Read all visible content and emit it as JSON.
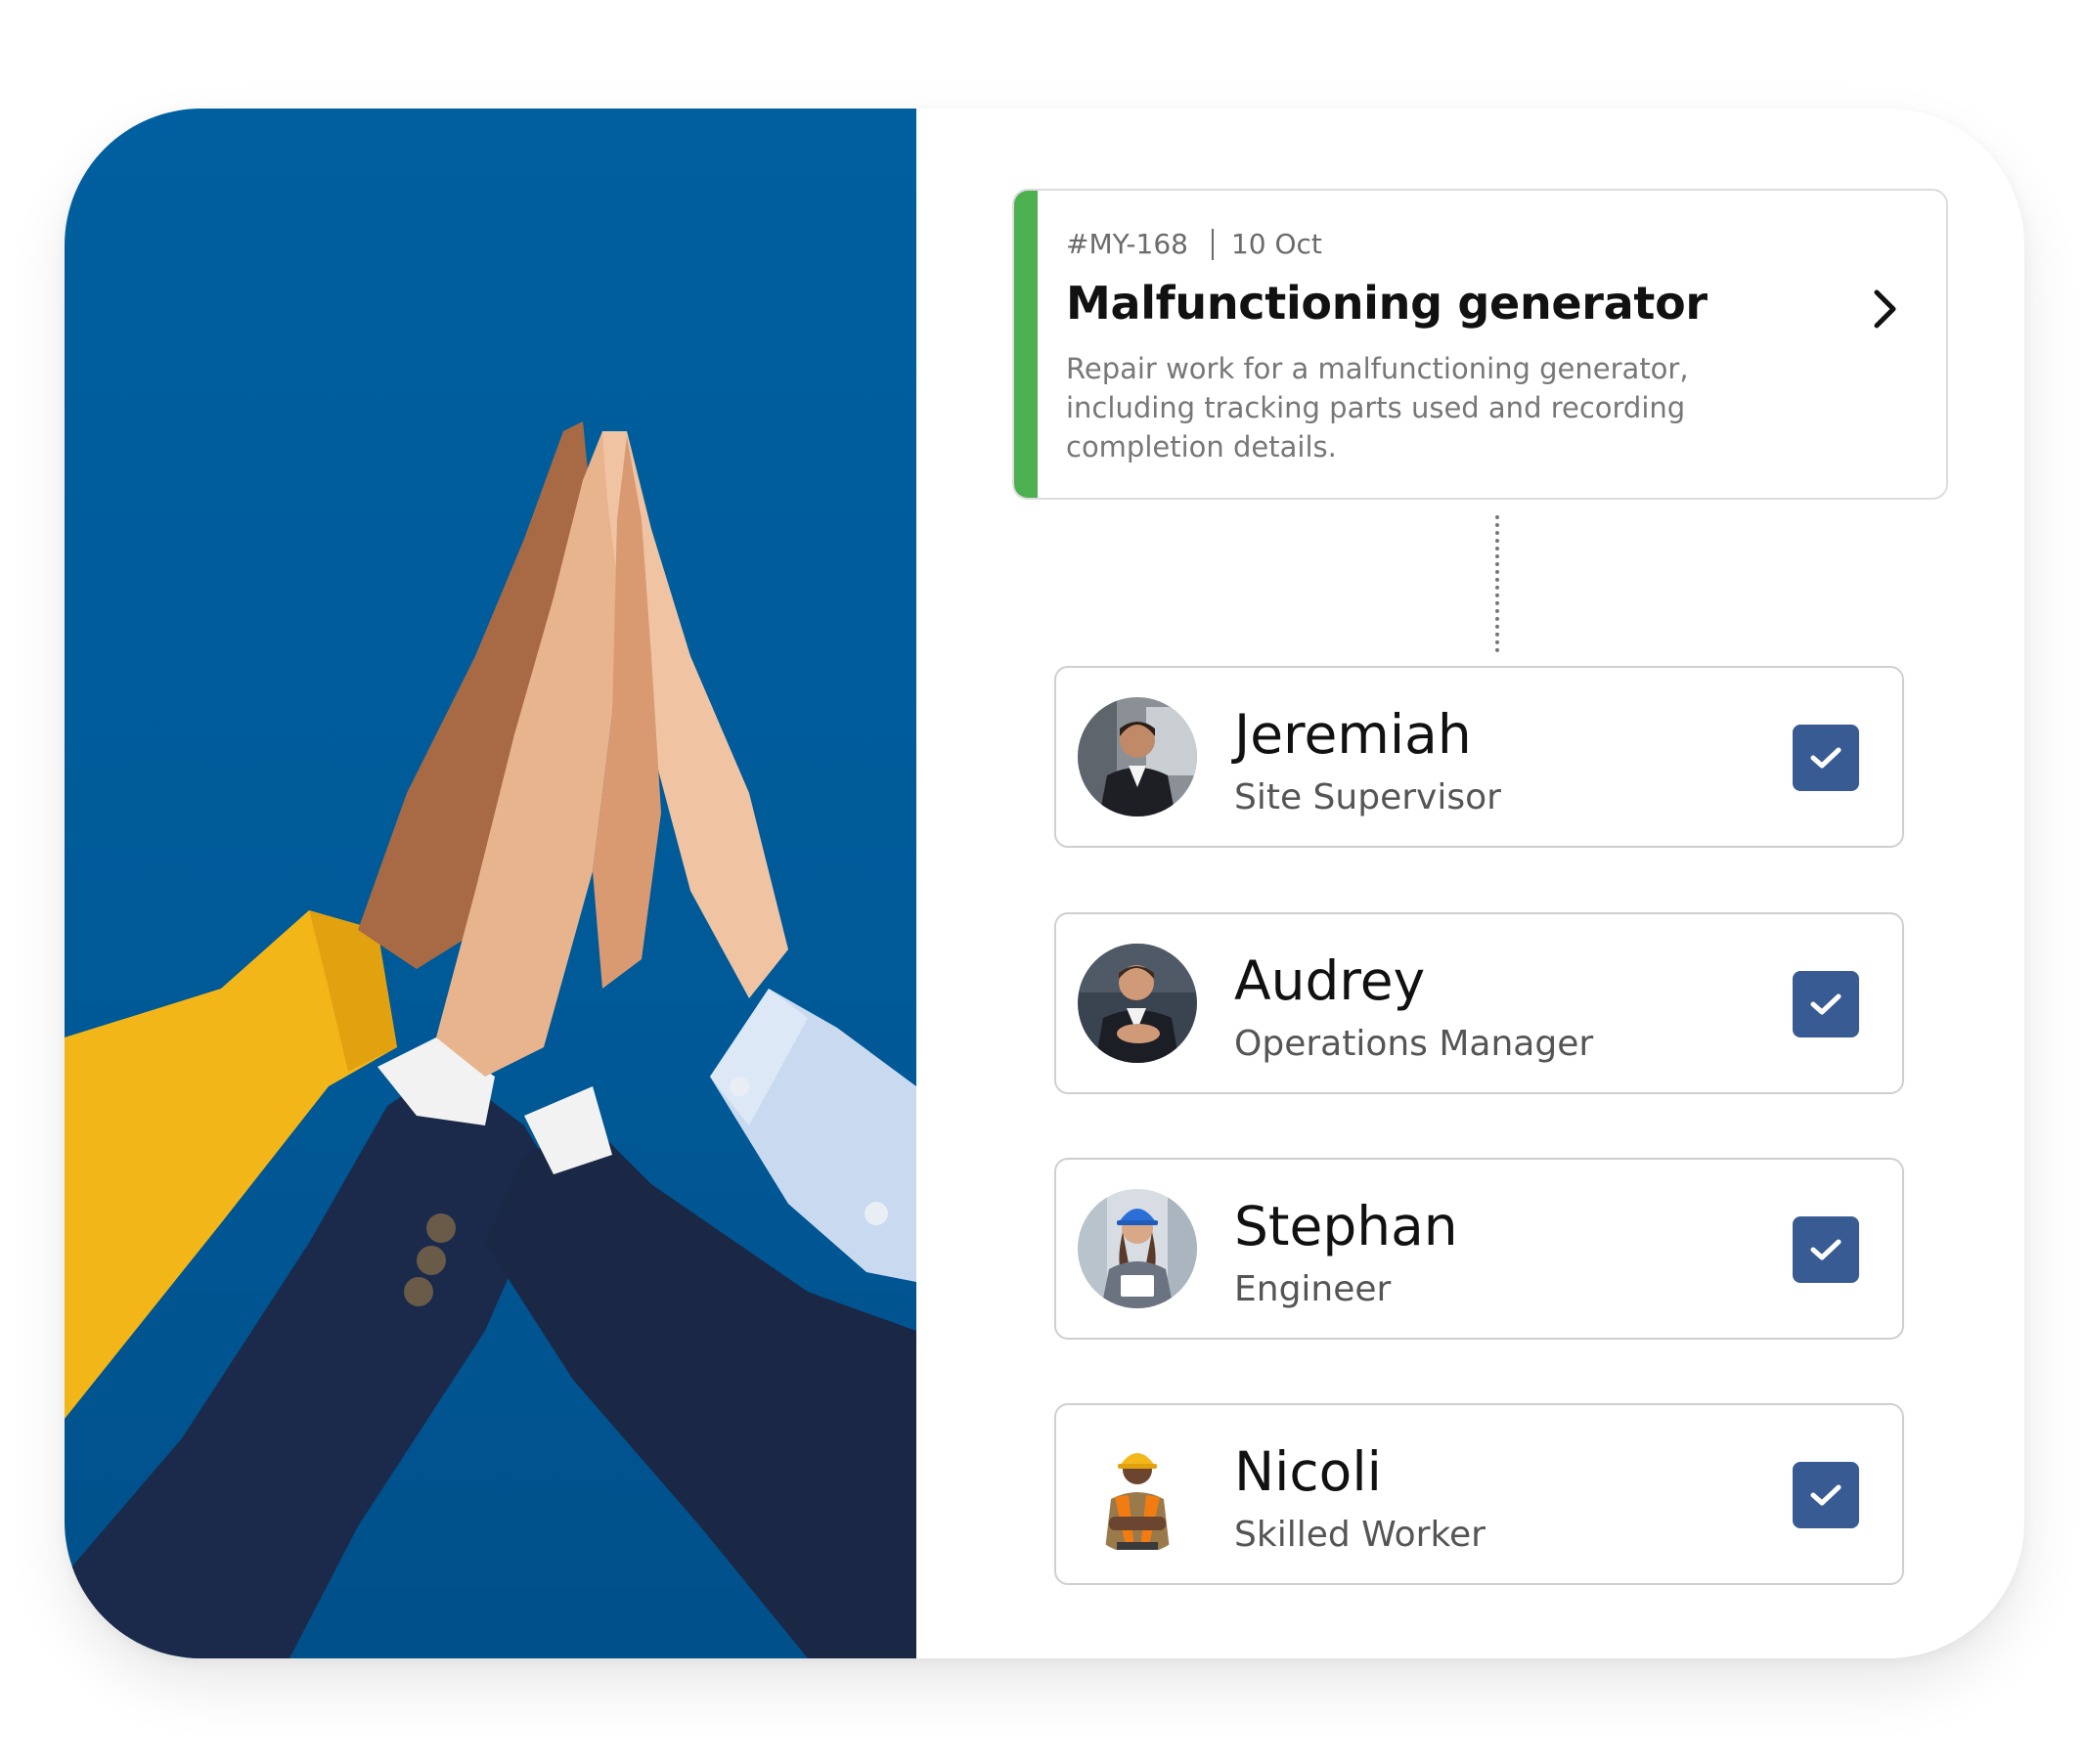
{
  "colors": {
    "photo_background": "#005f9e",
    "task_accent": "#4caf50",
    "checkbox": "#385b93",
    "card_border": "#cfcfcf"
  },
  "task": {
    "id": "#MY-168",
    "date": "10 Oct",
    "title": "Malfunctioning generator",
    "description": "Repair work for a malfunctioning generator, including tracking parts used and recording completion details.",
    "action_icon": "chevron-right-icon"
  },
  "assignees": [
    {
      "name": "Jeremiah",
      "role": "Site Supervisor",
      "checked": true
    },
    {
      "name": "Audrey",
      "role": "Operations Manager",
      "checked": true
    },
    {
      "name": "Stephan",
      "role": "Engineer",
      "checked": true
    },
    {
      "name": "Nicoli",
      "role": "Skilled Worker",
      "checked": true
    }
  ]
}
